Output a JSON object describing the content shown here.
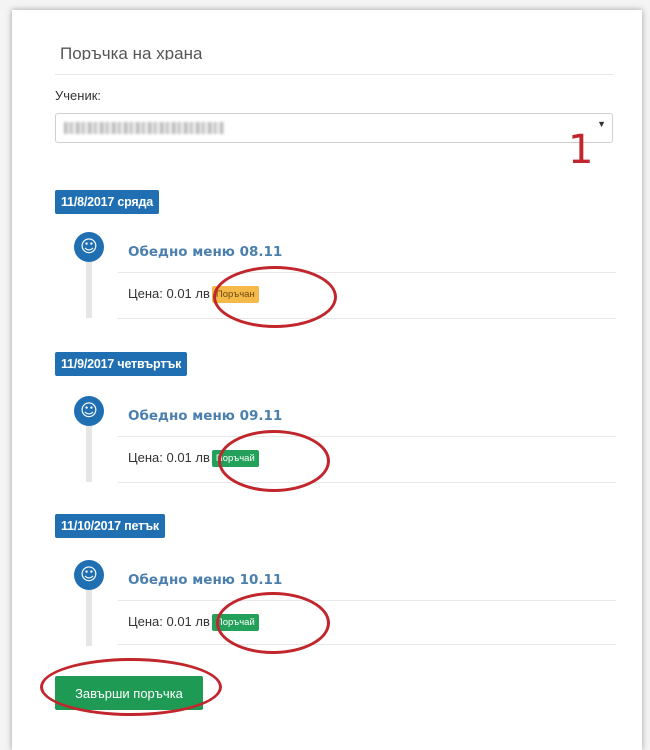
{
  "page": {
    "title": "Поръчка на храна"
  },
  "student": {
    "label": "Ученик:",
    "value_blurred": true
  },
  "annotation": {
    "number": "1"
  },
  "days": [
    {
      "date_label": "11/8/2017 сряда",
      "menu": "Обедно меню 08.11",
      "price": "Цена: 0.01 лв",
      "status": "Поръчан",
      "status_type": "ordered",
      "status_color": "#f5b94a"
    },
    {
      "date_label": "11/9/2017 четвъртък",
      "menu": "Обедно меню 09.11",
      "price": "Цена: 0.01 лв",
      "status": "Поръчай",
      "status_type": "order",
      "status_color": "#23a05a"
    },
    {
      "date_label": "11/10/2017 петък",
      "menu": "Обедно меню 10.11",
      "price": "Цена: 0.01 лв",
      "status": "Поръчай",
      "status_type": "order",
      "status_color": "#23a05a"
    }
  ],
  "actions": {
    "finish_label": "Завърши поръчка"
  },
  "colors": {
    "primary": "#1f6fb2",
    "success": "#1e9a55",
    "warning": "#f5b94a",
    "annotation": "#c0262c"
  },
  "icons": {
    "timeline": "smiley-icon",
    "select": "caret-down-icon"
  }
}
